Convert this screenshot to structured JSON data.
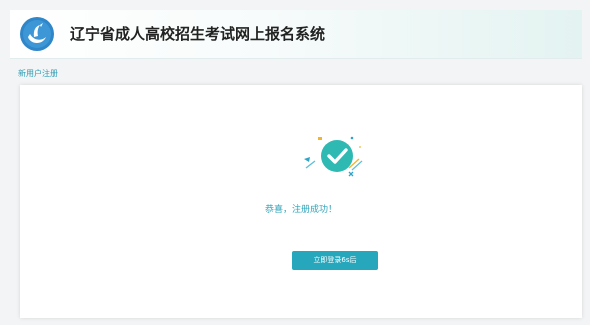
{
  "header": {
    "title": "辽宁省成人高校招生考试网上报名系统"
  },
  "breadcrumb": {
    "label": "新用户注册"
  },
  "result": {
    "message": "恭喜，注册成功！",
    "login_button_label": "立即登录6s后"
  },
  "colors": {
    "accent": "#26a7bb",
    "success_icon": "#2fb9b3",
    "header_gradient_end": "#e3f3f1"
  },
  "icons": {
    "logo": "swan-logo-icon",
    "success": "check-circle-icon"
  }
}
